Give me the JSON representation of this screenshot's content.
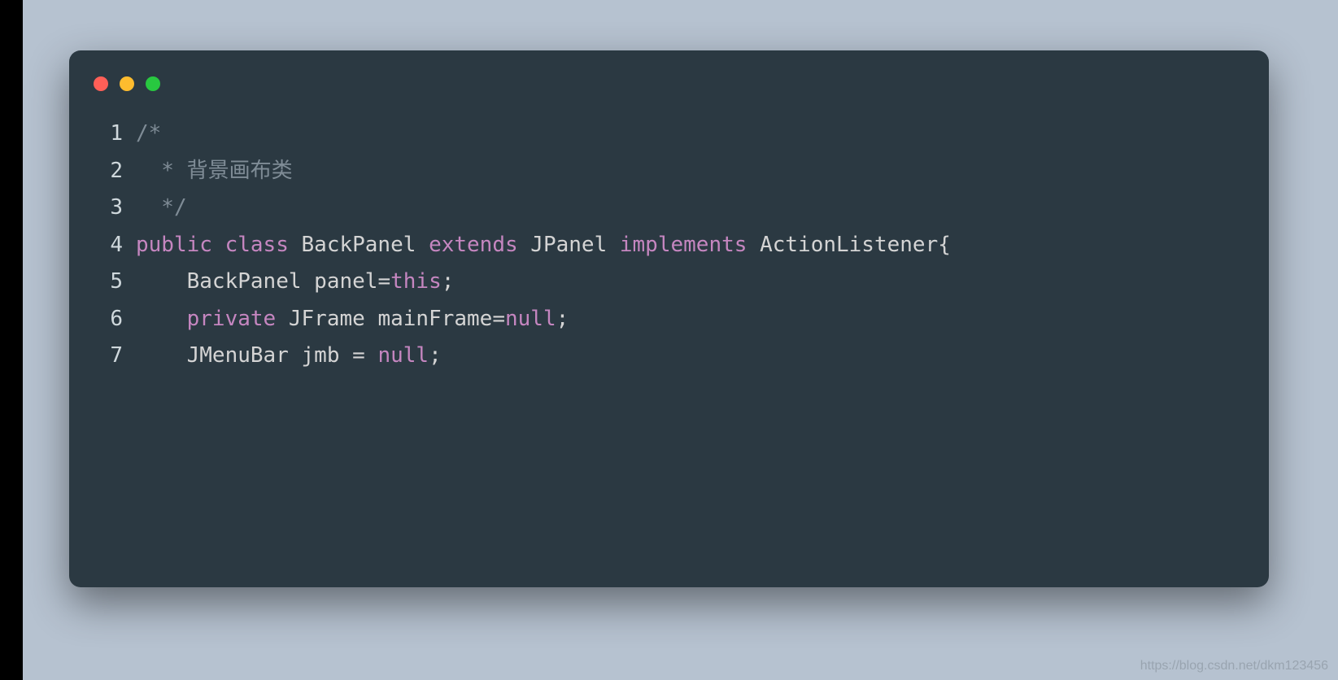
{
  "watermark": "https://blog.csdn.net/dkm123456",
  "traffic_lights": [
    "red",
    "yellow",
    "green"
  ],
  "code_lines": [
    {
      "n": "1",
      "tokens": [
        {
          "cls": "tok-comment",
          "t": "/*"
        }
      ]
    },
    {
      "n": "2",
      "tokens": [
        {
          "cls": "tok-comment",
          "t": "  * 背景画布类"
        }
      ]
    },
    {
      "n": "3",
      "tokens": [
        {
          "cls": "tok-comment",
          "t": "  */"
        }
      ]
    },
    {
      "n": "4",
      "tokens": [
        {
          "cls": "tok-keyword",
          "t": "public"
        },
        {
          "cls": "tok-plain",
          "t": " "
        },
        {
          "cls": "tok-keyword",
          "t": "class"
        },
        {
          "cls": "tok-plain",
          "t": " "
        },
        {
          "cls": "tok-type",
          "t": "BackPanel"
        },
        {
          "cls": "tok-plain",
          "t": " "
        },
        {
          "cls": "tok-keyword",
          "t": "extends"
        },
        {
          "cls": "tok-plain",
          "t": " "
        },
        {
          "cls": "tok-type",
          "t": "JPanel"
        },
        {
          "cls": "tok-plain",
          "t": " "
        },
        {
          "cls": "tok-keyword",
          "t": "implements"
        },
        {
          "cls": "tok-plain",
          "t": " "
        },
        {
          "cls": "tok-type",
          "t": "ActionListener"
        },
        {
          "cls": "tok-plain",
          "t": "{"
        }
      ]
    },
    {
      "n": "5",
      "tokens": [
        {
          "cls": "tok-plain",
          "t": "    "
        },
        {
          "cls": "tok-type",
          "t": "BackPanel"
        },
        {
          "cls": "tok-plain",
          "t": " "
        },
        {
          "cls": "tok-ident",
          "t": "panel"
        },
        {
          "cls": "tok-plain",
          "t": "="
        },
        {
          "cls": "tok-literal",
          "t": "this"
        },
        {
          "cls": "tok-plain",
          "t": ";"
        }
      ]
    },
    {
      "n": "6",
      "tokens": [
        {
          "cls": "tok-plain",
          "t": "    "
        },
        {
          "cls": "tok-keyword",
          "t": "private"
        },
        {
          "cls": "tok-plain",
          "t": " "
        },
        {
          "cls": "tok-type",
          "t": "JFrame"
        },
        {
          "cls": "tok-plain",
          "t": " "
        },
        {
          "cls": "tok-ident",
          "t": "mainFrame"
        },
        {
          "cls": "tok-plain",
          "t": "="
        },
        {
          "cls": "tok-literal",
          "t": "null"
        },
        {
          "cls": "tok-plain",
          "t": ";"
        }
      ]
    },
    {
      "n": "7",
      "tokens": [
        {
          "cls": "tok-plain",
          "t": "    "
        },
        {
          "cls": "tok-type",
          "t": "JMenuBar"
        },
        {
          "cls": "tok-plain",
          "t": " "
        },
        {
          "cls": "tok-ident",
          "t": "jmb"
        },
        {
          "cls": "tok-plain",
          "t": " = "
        },
        {
          "cls": "tok-literal",
          "t": "null"
        },
        {
          "cls": "tok-plain",
          "t": ";"
        }
      ]
    }
  ]
}
